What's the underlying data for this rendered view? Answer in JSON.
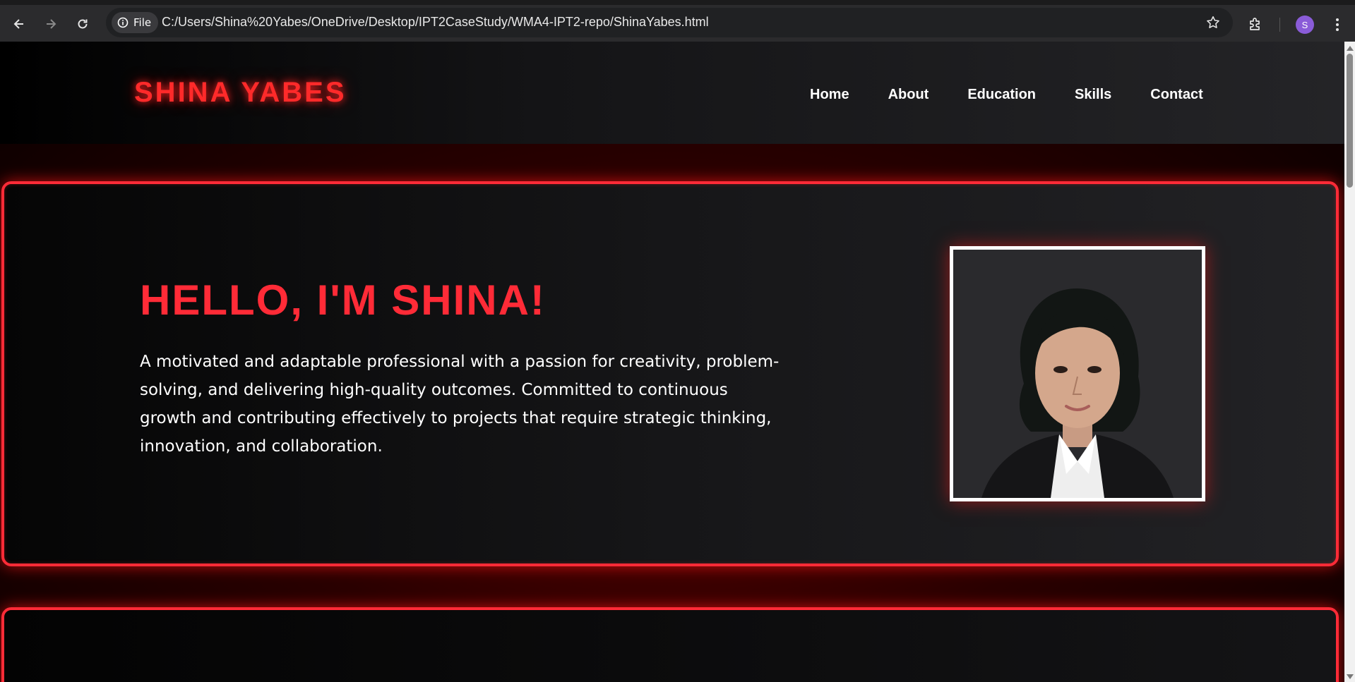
{
  "browser": {
    "back_icon": "arrow-left-icon",
    "forward_icon": "arrow-right-icon",
    "reload_icon": "reload-icon",
    "file_chip_label": "File",
    "url": "C:/Users/Shina%20Yabes/OneDrive/Desktop/IPT2CaseStudy/WMA4-IPT2-repo/ShinaYabes.html",
    "profile_initial": "S",
    "accent_color": "#8a5cd8"
  },
  "site": {
    "logo": "SHINA YABES",
    "nav": [
      {
        "label": "Home"
      },
      {
        "label": "About"
      },
      {
        "label": "Education"
      },
      {
        "label": "Skills"
      },
      {
        "label": "Contact"
      }
    ],
    "hero": {
      "heading": "HELLO, I'M SHINA!",
      "description": "A motivated and adaptable professional with a passion for creativity, problem-solving, and delivering high-quality outcomes. Committed to continuous growth and contributing effectively to projects that require strategic thinking, innovation, and collaboration."
    },
    "colors": {
      "accent_red": "#ff2b37",
      "background": "#000000",
      "text": "#ffffff"
    }
  }
}
